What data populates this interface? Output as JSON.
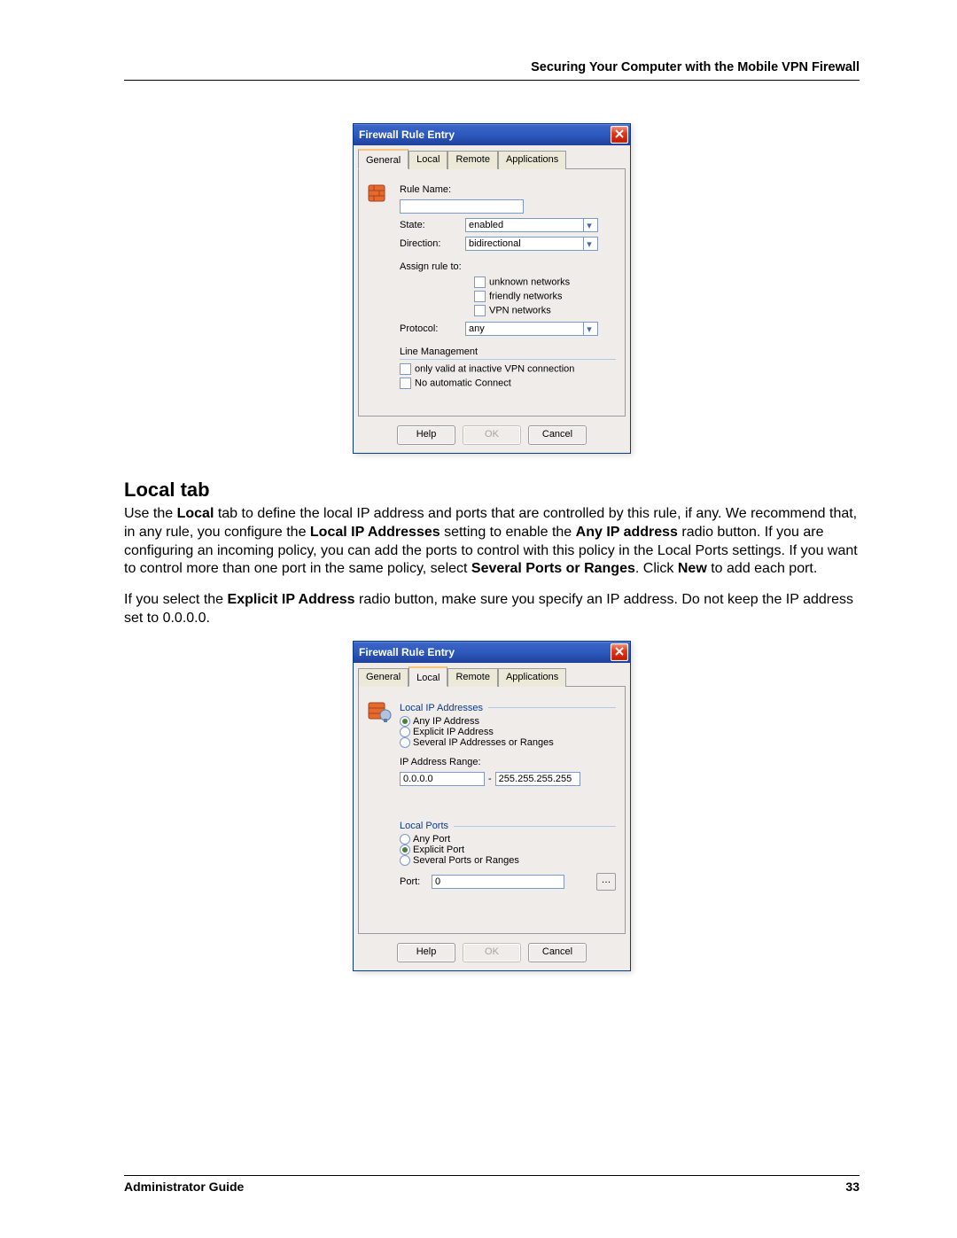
{
  "header": {
    "chapter_title": "Securing Your Computer with the Mobile VPN Firewall"
  },
  "dialog1": {
    "title": "Firewall Rule Entry",
    "tabs": [
      "General",
      "Local",
      "Remote",
      "Applications"
    ],
    "active_tab": "General",
    "labels": {
      "rule_name": "Rule Name:",
      "state": "State:",
      "direction": "Direction:",
      "assign": "Assign rule to:",
      "protocol": "Protocol:",
      "line_mgmt": "Line Management"
    },
    "values": {
      "state": "enabled",
      "direction": "bidirectional",
      "protocol": "any"
    },
    "opts": {
      "unknown": "unknown networks",
      "friendly": "friendly networks",
      "vpn": "VPN networks"
    },
    "checks": {
      "only_valid": "only valid at inactive VPN connection",
      "no_auto": "No automatic Connect"
    },
    "buttons": {
      "help": "Help",
      "ok": "OK",
      "cancel": "Cancel"
    }
  },
  "heading": "Local tab",
  "para1": {
    "t1": "Use the ",
    "b1": "Local",
    "t2": " tab to define the local IP address and ports that are controlled by this rule, if any. We recommend that, in any rule, you configure the ",
    "b2": "Local IP Addresses",
    "t3": " setting to enable the ",
    "b3": "Any IP address",
    "t4": " radio button. If you are configuring an incoming policy, you can add the ports to control with this policy in the Local Ports settings. If you want to control more than one port in the same policy, select ",
    "b4": "Several Ports or Ranges",
    "t5": ". Click ",
    "b5": "New",
    "t6": " to add each port."
  },
  "para2": {
    "t1": "If you select the ",
    "b1": "Explicit IP Address",
    "t2": " radio button, make sure you specify an IP address. Do not keep the IP address set to 0.0.0.0."
  },
  "dialog2": {
    "title": "Firewall Rule Entry",
    "tabs": [
      "General",
      "Local",
      "Remote",
      "Applications"
    ],
    "active_tab": "Local",
    "group1": {
      "legend": "Local IP Addresses",
      "r1": "Any IP Address",
      "r2": "Explicit IP Address",
      "r3": "Several IP Addresses or Ranges",
      "range_label": "IP Address Range:",
      "from": "0.0.0.0",
      "to": "255.255.255.255"
    },
    "group2": {
      "legend": "Local Ports",
      "r1": "Any Port",
      "r2": "Explicit Port",
      "r3": "Several Ports or Ranges",
      "port_label": "Port:",
      "port_value": "0"
    },
    "buttons": {
      "help": "Help",
      "ok": "OK",
      "cancel": "Cancel"
    }
  },
  "footer": {
    "left": "Administrator Guide",
    "right": "33"
  }
}
